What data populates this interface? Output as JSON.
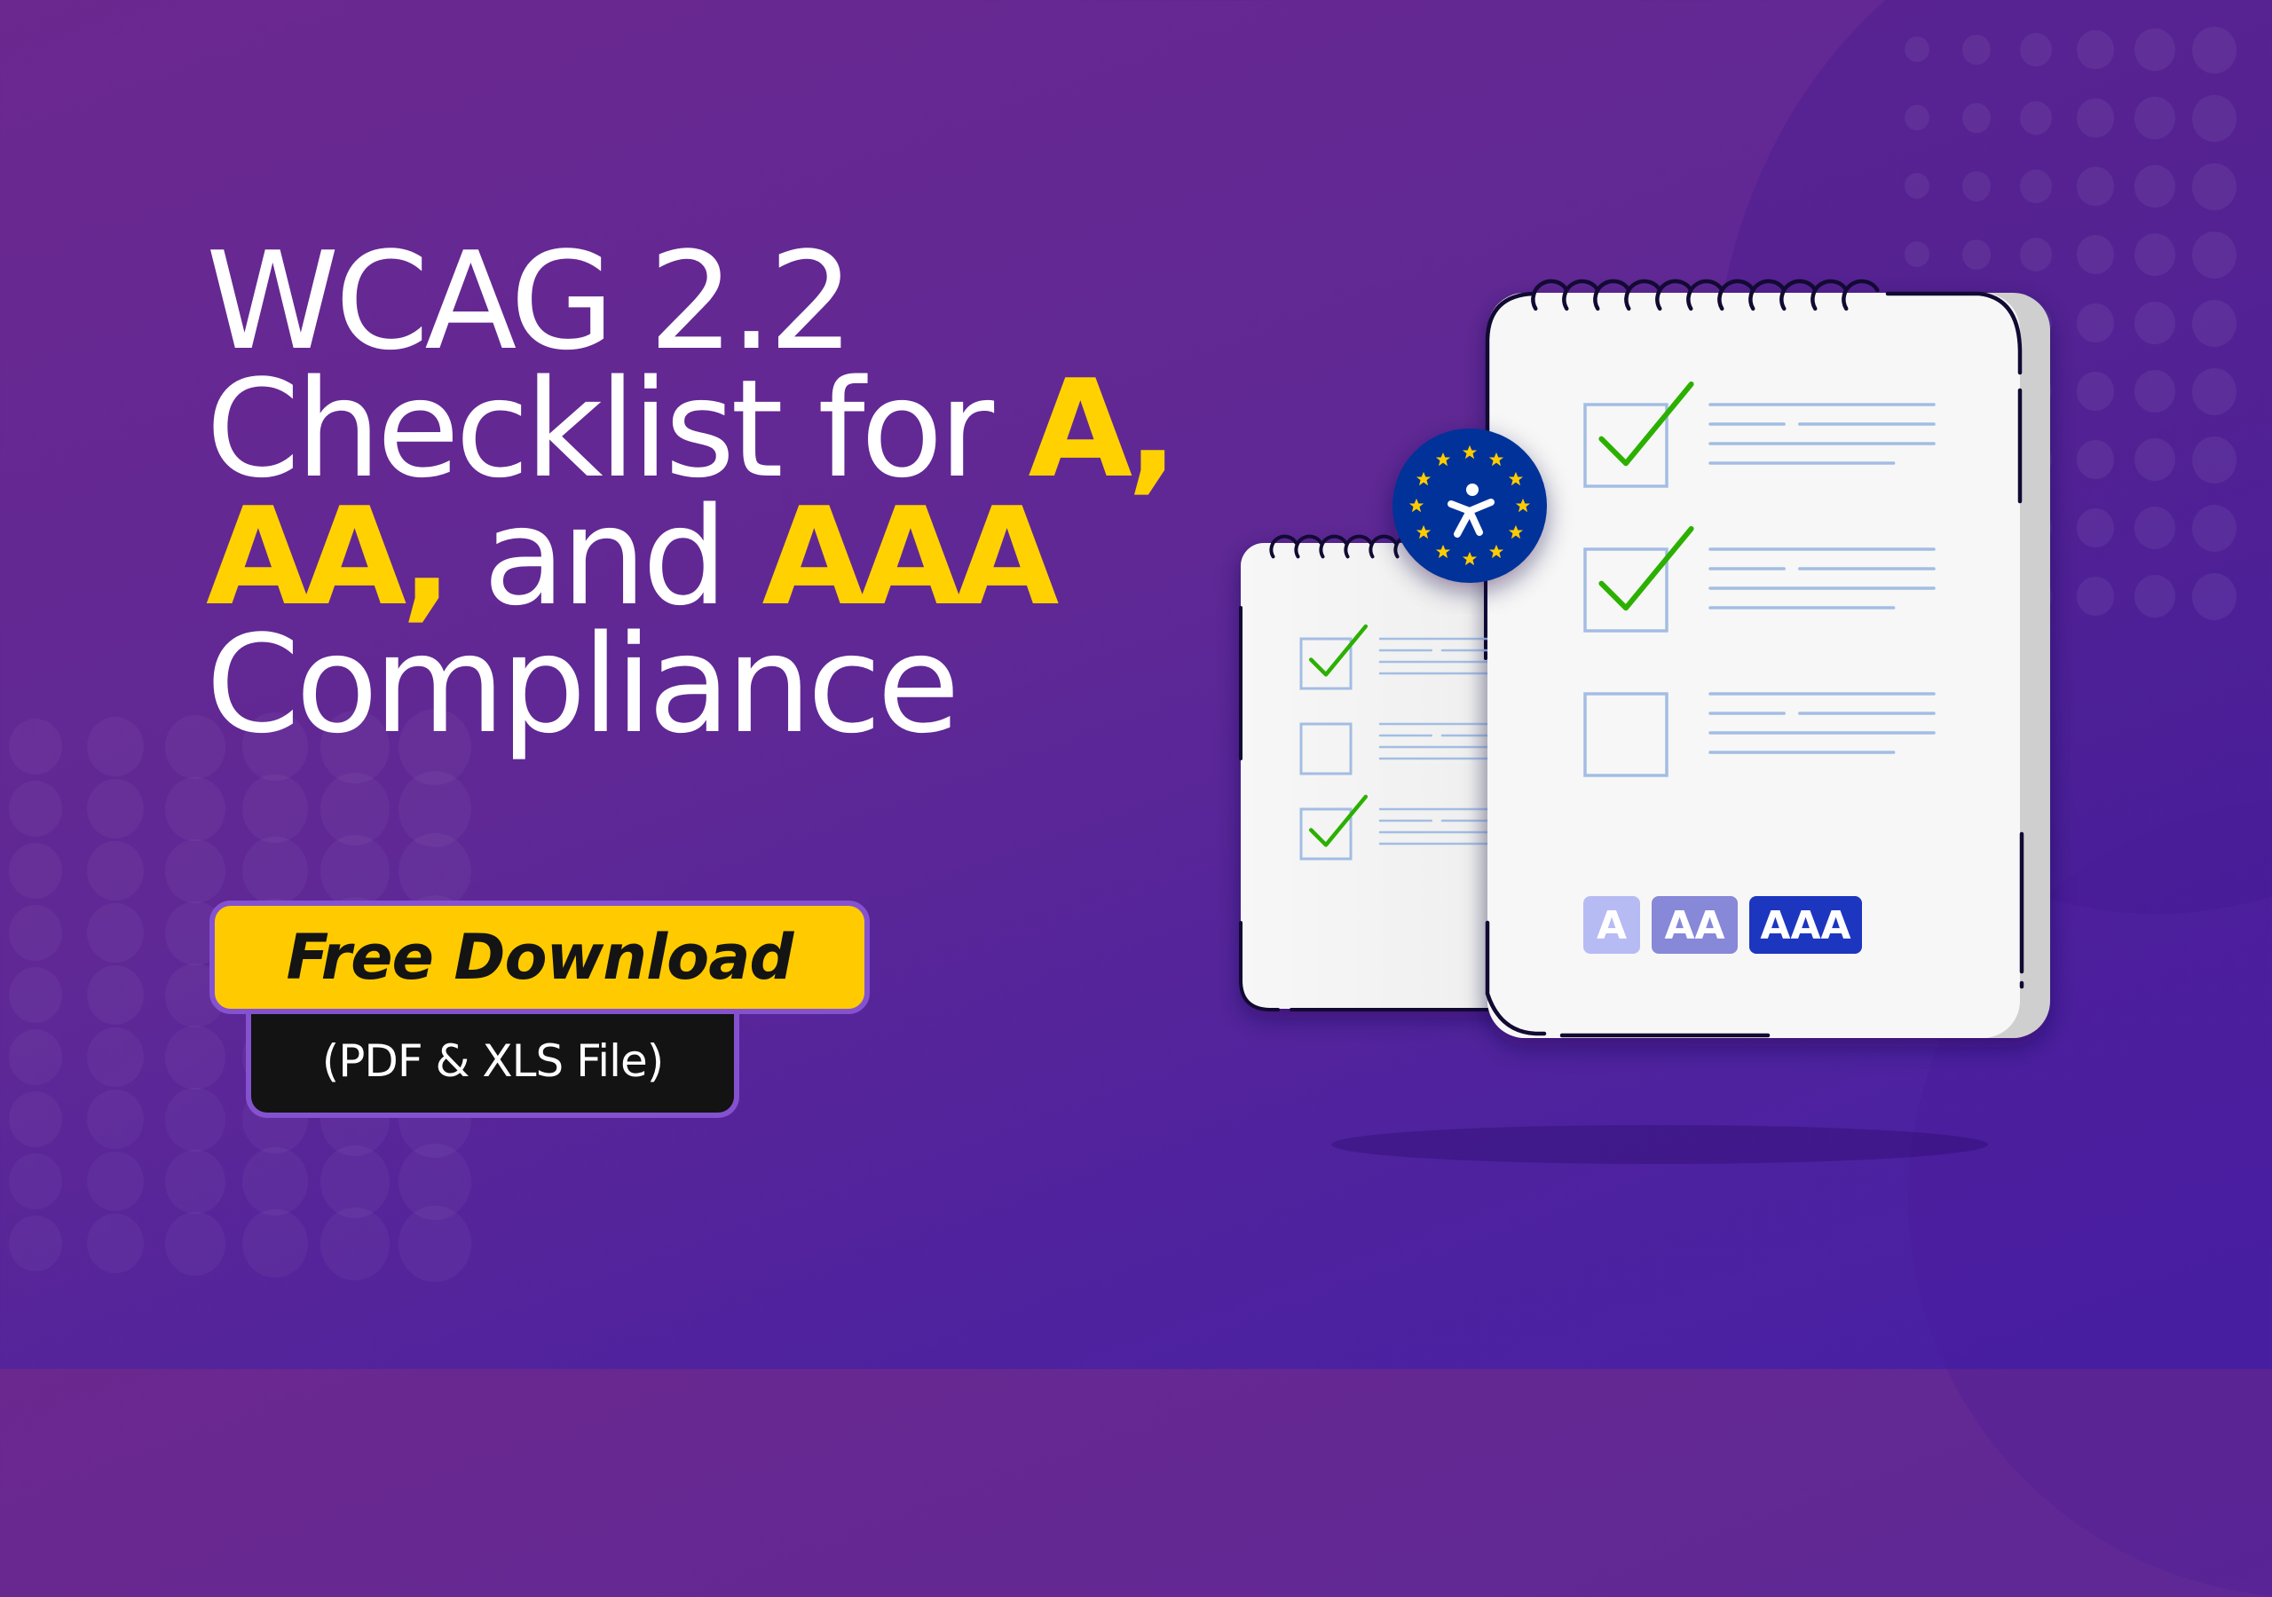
{
  "headline": {
    "line1": "WCAG 2.2",
    "line2_prefix": "Checklist for ",
    "line2_highlight": "A,",
    "line3_highlight1": "AA,",
    "line3_middle": " and ",
    "line3_highlight2": "AAA",
    "line4": "Compliance"
  },
  "cta": {
    "button_label": "Free Download",
    "sub_label": "(PDF & XLS File)"
  },
  "illustration": {
    "badge_icon": "accessibility-person-icon",
    "badge_stars": 12,
    "small_checklist": [
      {
        "checked": true
      },
      {
        "checked": false
      },
      {
        "checked": true
      }
    ],
    "large_checklist": [
      {
        "checked": true
      },
      {
        "checked": true
      },
      {
        "checked": false
      }
    ],
    "levels": [
      {
        "label": "A",
        "color": "#b7bbf3"
      },
      {
        "label": "AA",
        "color": "#8788d8"
      },
      {
        "label": "AAA",
        "color": "#1d36c0"
      }
    ]
  },
  "colors": {
    "accent_yellow": "#ffd100",
    "button_yellow": "#ffcb00",
    "button_border": "#8552cf",
    "check_green": "#2cb000",
    "checkbox_blue": "#a3bde3",
    "badge_blue": "#013399",
    "star_yellow": "#ffcc00"
  }
}
